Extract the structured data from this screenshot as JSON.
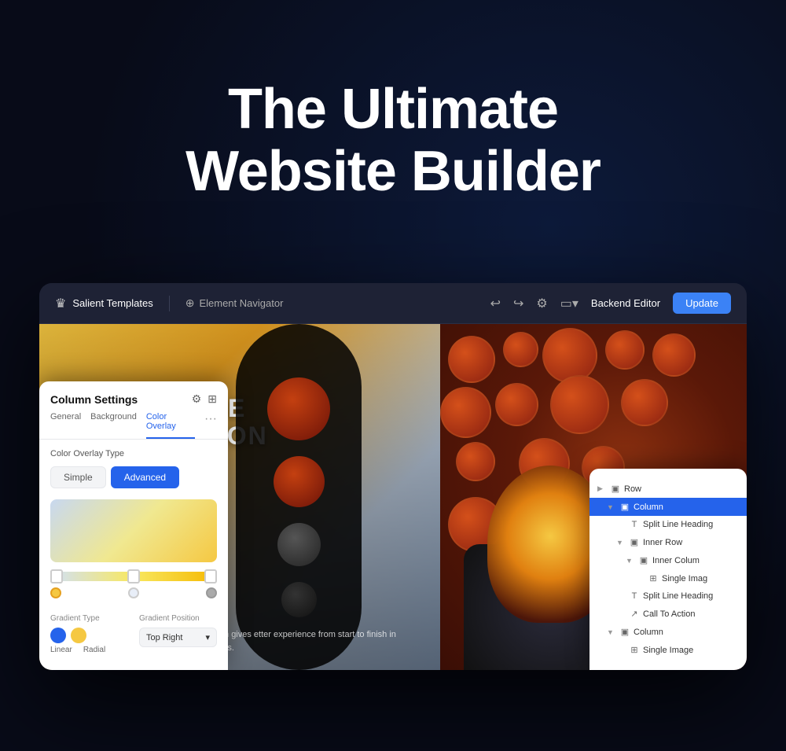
{
  "hero": {
    "title_line1": "The Ultimate",
    "title_line2": "Website Builder"
  },
  "topbar": {
    "logo_label": "Salient Templates",
    "nav_label": "Element Navigator",
    "backend_btn": "Backend Editor",
    "update_btn": "Update"
  },
  "canvas": {
    "deep_space_line1": "DEEP SPACE",
    "deep_space_line2": "EXPLORATION",
    "body_text": "successful business growth. Our platform gives etter experience from start to finish in order for easily turn them into lifelong fans."
  },
  "column_settings": {
    "title": "Column Settings",
    "tabs": [
      "General",
      "Background",
      "Color Overlay"
    ],
    "active_tab": "Color Overlay",
    "overlay_type_label": "Color Overlay Type",
    "btn_simple": "Simple",
    "btn_advanced": "Advanced",
    "gradient_type_label": "Gradient Type",
    "gradient_pos_label": "Gradient Position",
    "gradient_pos_value": "Top Right",
    "type_linear": "Linear",
    "type_radial": "Radial"
  },
  "right_panel": {
    "items": [
      {
        "id": "row",
        "label": "Row",
        "indent": 0,
        "icon": "▣",
        "expand": "▶"
      },
      {
        "id": "column",
        "label": "Column",
        "indent": 1,
        "icon": "▣",
        "expand": "▼",
        "highlighted": true
      },
      {
        "id": "split-line-heading",
        "label": "Split Line Heading",
        "indent": 2,
        "icon": "T",
        "expand": ""
      },
      {
        "id": "inner-row",
        "label": "Inner Row",
        "indent": 2,
        "icon": "▣",
        "expand": "▼"
      },
      {
        "id": "inner-column",
        "label": "Inner Colum",
        "indent": 3,
        "icon": "▣",
        "expand": "▼"
      },
      {
        "id": "single-image",
        "label": "Single Imag",
        "indent": 4,
        "icon": "⊞",
        "expand": ""
      },
      {
        "id": "split-line-heading-2",
        "label": "Split Line Heading",
        "indent": 2,
        "icon": "T",
        "expand": ""
      },
      {
        "id": "call-to-action",
        "label": "Call To Action",
        "indent": 2,
        "icon": "↗",
        "expand": ""
      },
      {
        "id": "column-2",
        "label": "Column",
        "indent": 1,
        "icon": "▣",
        "expand": "▼"
      },
      {
        "id": "single-image-2",
        "label": "Single Image",
        "indent": 2,
        "icon": "⊞",
        "expand": ""
      }
    ]
  }
}
